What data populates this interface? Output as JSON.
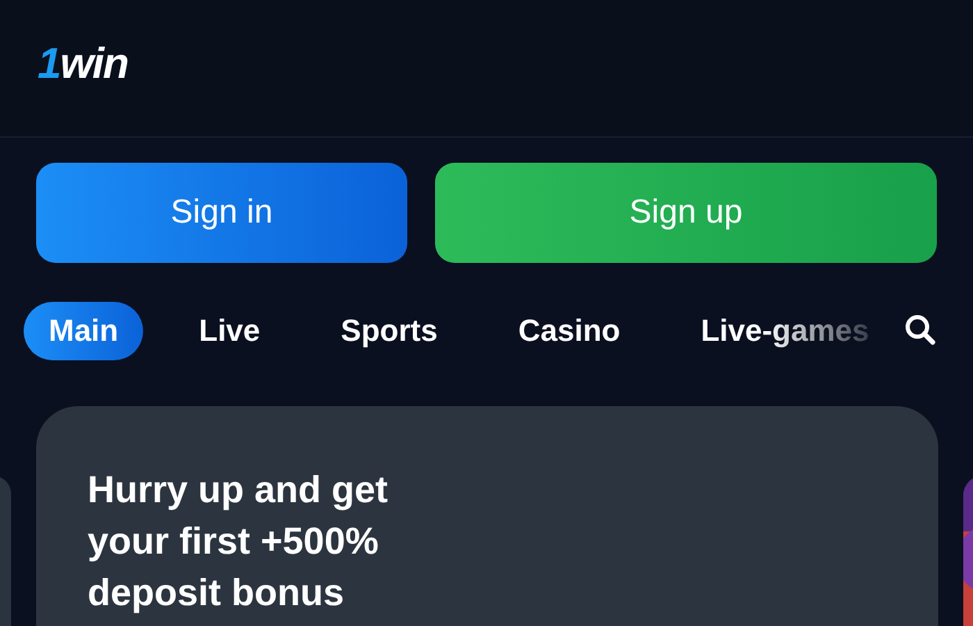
{
  "header": {
    "logo": {
      "mark": "1",
      "word": "win"
    }
  },
  "auth_buttons": [
    {
      "label": "Sign in",
      "kind": "primary"
    },
    {
      "label": "Sign up",
      "kind": "success"
    }
  ],
  "tabs": [
    {
      "label": "Main",
      "selected": true
    },
    {
      "label": "Live",
      "selected": false
    },
    {
      "label": "Sports",
      "selected": false
    },
    {
      "label": "Casino",
      "selected": false
    },
    {
      "label": "Live-games",
      "selected": false
    }
  ],
  "banner": {
    "headline": "Hurry up and get your first +500% deposit bonus"
  }
}
